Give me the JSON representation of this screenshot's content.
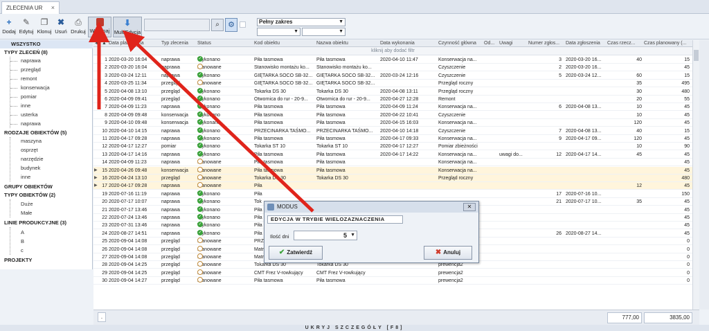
{
  "tab": {
    "label": "ZLECENIA UR"
  },
  "toolbar": {
    "buttons": [
      {
        "label": "Dodaj",
        "icon": "plus-icon"
      },
      {
        "label": "Edytuj",
        "icon": "pencil-icon"
      },
      {
        "label": "Klonuj",
        "icon": "copy-icon"
      },
      {
        "label": "Usuń",
        "icon": "x-icon"
      },
      {
        "label": "Drukuj",
        "icon": "printer-icon"
      },
      {
        "label": "Wykonaj",
        "icon": "execute-icon"
      },
      {
        "label": "MultiEdycja",
        "icon": "multiedit-icon"
      }
    ],
    "range_value": "Pełny zakres"
  },
  "sidebar": {
    "all": "WSZYSTKO",
    "types_header": "TYPY ZLECEŃ (8)",
    "types": [
      "naprawa",
      "przegląd",
      "remont",
      "konserwacja",
      "pomiar",
      "inne",
      "usterka",
      "naprawa"
    ],
    "kinds_header": "RODZAJE OBIEKTÓW (5)",
    "kinds": [
      "maszyna",
      "osprzęt",
      "narzędzie",
      "budynek",
      "inne"
    ],
    "groups_header": "GRUPY OBIEKTÓW",
    "objtypes_header": "TYPY OBIEKTÓW (2)",
    "objtypes": [
      "Duże",
      "Małe"
    ],
    "lines_header": "LINIE PRODUKCYJNE (3)",
    "lines": [
      "A",
      "B",
      "c"
    ],
    "projects": "PROJEKTY"
  },
  "grid": {
    "columns": [
      "Data planowana",
      "Typ zlecenia",
      "Status",
      "Kod obiektu",
      "Nazwa obiektu",
      "Data wykonania",
      "Czynność główna",
      "Od...",
      "Uwagi",
      "Numer zgłos...",
      "Data zgłoszenia",
      "Czas rzecz...",
      "Czas planowany (..."
    ],
    "filter_hint": "kliknij aby dodać filtr",
    "rows": [
      {
        "n": "1",
        "d": "2020-03-20 16:04",
        "t": "naprawa",
        "s": "Wykonano",
        "k": "Piła tasmowa",
        "nz": "Piła tasmowa",
        "dw": "2020-04-10 11:47",
        "c": "Konserwacja na...",
        "u": "",
        "nr": "3",
        "dz": "2020-03-20 16...",
        "cr": "40",
        "cp": "15",
        "hl": false,
        "ok": true
      },
      {
        "n": "2",
        "d": "2020-03-20 16:04",
        "t": "naprawa",
        "s": "Planowane",
        "k": "Stanowisko montażu ko...",
        "nz": "Stanowisko montażu ko...",
        "dw": "",
        "c": "Czyszczenie",
        "u": "",
        "nr": "2",
        "dz": "2020-03-20 16...",
        "cr": "",
        "cp": "45",
        "hl": false,
        "ok": false
      },
      {
        "n": "3",
        "d": "2020-03-24 12:11",
        "t": "naprawa",
        "s": "Wykonano",
        "k": "GIĘTARKA SOCO SB-32...",
        "nz": "GIĘTARKA SOCO SB-32...",
        "dw": "2020-03-24 12:16",
        "c": "Czyszczenie",
        "u": "",
        "nr": "5",
        "dz": "2020-03-24 12...",
        "cr": "60",
        "cp": "15",
        "hl": false,
        "ok": true
      },
      {
        "n": "4",
        "d": "2020-03-25 11:34",
        "t": "przegląd",
        "s": "Planowane",
        "k": "GIĘTARKA SOCO SB-32...",
        "nz": "GIĘTARKA SOCO SB-32...",
        "dw": "",
        "c": "Przegląd roczny",
        "u": "",
        "nr": "",
        "dz": "",
        "cr": "35",
        "cp": "495",
        "hl": false,
        "ok": false
      },
      {
        "n": "5",
        "d": "2020-04-08 13:10",
        "t": "przegląd",
        "s": "Wykonano",
        "k": "Tokarka DS 30",
        "nz": "Tokarka DS 30",
        "dw": "2020-04-08 13:11",
        "c": "Przegląd roczny",
        "u": "",
        "nr": "",
        "dz": "",
        "cr": "30",
        "cp": "480",
        "hl": false,
        "ok": true
      },
      {
        "n": "6",
        "d": "2020-04-09 09:41",
        "t": "przegląd",
        "s": "Wykonano",
        "k": "Otwornica do rur - 20-9...",
        "nz": "Otwornica do rur - 20-9...",
        "dw": "2020-04-27 12:28",
        "c": "Remont",
        "u": "",
        "nr": "",
        "dz": "",
        "cr": "20",
        "cp": "55",
        "hl": false,
        "ok": true
      },
      {
        "n": "7",
        "d": "2020-04-09 11:23",
        "t": "naprawa",
        "s": "Wykonano",
        "k": "Piła tasmowa",
        "nz": "Piła tasmowa",
        "dw": "2020-04-09 11:24",
        "c": "Konserwacja na...",
        "u": "",
        "nr": "6",
        "dz": "2020-04-08 13...",
        "cr": "10",
        "cp": "45",
        "hl": false,
        "ok": true
      },
      {
        "n": "8",
        "d": "2020-04-09 09:48",
        "t": "konserwacja",
        "s": "Wykonano",
        "k": "Piła tasmowa",
        "nz": "Piła tasmowa",
        "dw": "2020-04-22 10:41",
        "c": "Czyszczenie",
        "u": "",
        "nr": "",
        "dz": "",
        "cr": "10",
        "cp": "45",
        "hl": false,
        "ok": true
      },
      {
        "n": "9",
        "d": "2020-04-10 09:48",
        "t": "konserwacja",
        "s": "Wykonano",
        "k": "Piła tasmowa",
        "nz": "Piła tasmowa",
        "dw": "2020-04-15 16:03",
        "c": "Konserwacja na...",
        "u": "",
        "nr": "",
        "dz": "",
        "cr": "120",
        "cp": "45",
        "hl": false,
        "ok": true
      },
      {
        "n": "10",
        "d": "2020-04-10 14:15",
        "t": "naprawa",
        "s": "Wykonano",
        "k": "PRZECINARKA TAŚMO...",
        "nz": "PRZECINARKA TAŚMO...",
        "dw": "2020-04-10 14:18",
        "c": "Czyszczenie",
        "u": "",
        "nr": "7",
        "dz": "2020-04-08 13...",
        "cr": "40",
        "cp": "15",
        "hl": false,
        "ok": true
      },
      {
        "n": "11",
        "d": "2020-04-17 09:28",
        "t": "naprawa",
        "s": "Wykonano",
        "k": "Piła tasmowa",
        "nz": "Piła tasmowa",
        "dw": "2020-04-17 09:33",
        "c": "Konserwacja na...",
        "u": "",
        "nr": "9",
        "dz": "2020-04-17 09...",
        "cr": "120",
        "cp": "45",
        "hl": false,
        "ok": true
      },
      {
        "n": "12",
        "d": "2020-04-17 12:27",
        "t": "pomiar",
        "s": "Wykonano",
        "k": "Tokarka ST 10",
        "nz": "Tokarka ST 10",
        "dw": "2020-04-17 12:27",
        "c": "Pomiar zbieżności",
        "u": "",
        "nr": "",
        "dz": "",
        "cr": "10",
        "cp": "90",
        "hl": false,
        "ok": true
      },
      {
        "n": "13",
        "d": "2020-04-17 14:16",
        "t": "naprawa",
        "s": "Wykonano",
        "k": "Piła tasmowa",
        "nz": "Piła tasmowa",
        "dw": "2020-04-17 14:22",
        "c": "Konserwacja na...",
        "u": "uwagi do...",
        "nr": "12",
        "dz": "2020-04-17 14...",
        "cr": "45",
        "cp": "45",
        "hl": false,
        "ok": true
      },
      {
        "n": "14",
        "d": "2020-04-09 11:23",
        "t": "naprawa",
        "s": "Planowane",
        "k": "Piła tasmowa",
        "nz": "Piła tasmowa",
        "dw": "",
        "c": "Konserwacja na...",
        "u": "",
        "nr": "",
        "dz": "",
        "cr": "",
        "cp": "45",
        "hl": false,
        "ok": false
      },
      {
        "n": "15",
        "d": "2020-04-26 09:48",
        "t": "konserwacja",
        "s": "Planowane",
        "k": "Piła tasmowa",
        "nz": "Piła tasmowa",
        "dw": "",
        "c": "Konserwacja na...",
        "u": "",
        "nr": "",
        "dz": "",
        "cr": "",
        "cp": "45",
        "hl": true,
        "ok": false
      },
      {
        "n": "16",
        "d": "2020-04-24 13:10",
        "t": "przegląd",
        "s": "Planowane",
        "k": "Tokarka DS 30",
        "nz": "Tokarka DS 30",
        "dw": "",
        "c": "Przegląd roczny",
        "u": "",
        "nr": "",
        "dz": "",
        "cr": "",
        "cp": "480",
        "hl": true,
        "ok": false
      },
      {
        "n": "17",
        "d": "2020-04-17 09:28",
        "t": "naprawa",
        "s": "Planowane",
        "k": "Piła",
        "nz": "",
        "dw": "",
        "c": "",
        "u": "",
        "nr": "",
        "dz": "",
        "cr": "12",
        "cp": "45",
        "hl": true,
        "ok": false
      },
      {
        "n": "19",
        "d": "2020-07-16 11:19",
        "t": "naprawa",
        "s": "Wykonano",
        "k": "Piła",
        "nz": "",
        "dw": "",
        "c": "",
        "u": "",
        "nr": "17",
        "dz": "2020-07-16 10...",
        "cr": "",
        "cp": "150",
        "hl": false,
        "ok": true
      },
      {
        "n": "20",
        "d": "2020-07-17 10:07",
        "t": "naprawa",
        "s": "Wykonano",
        "k": "Tok",
        "nz": "",
        "dw": "",
        "c": "",
        "u": "",
        "nr": "21",
        "dz": "2020-07-17 10...",
        "cr": "35",
        "cp": "45",
        "hl": false,
        "ok": true
      },
      {
        "n": "21",
        "d": "2020-07-17 13:46",
        "t": "naprawa",
        "s": "Wykonano",
        "k": "Piła",
        "nz": "",
        "dw": "",
        "c": "",
        "u": "",
        "nr": "",
        "dz": "",
        "cr": "",
        "cp": "45",
        "hl": false,
        "ok": true
      },
      {
        "n": "22",
        "d": "2020-07-24 13:46",
        "t": "naprawa",
        "s": "Wykonano",
        "k": "Piła",
        "nz": "",
        "dw": "",
        "c": "",
        "u": "",
        "nr": "",
        "dz": "",
        "cr": "",
        "cp": "45",
        "hl": false,
        "ok": true
      },
      {
        "n": "23",
        "d": "2020-07-31 13:46",
        "t": "naprawa",
        "s": "Wykonano",
        "k": "Piła",
        "nz": "",
        "dw": "",
        "c": "",
        "u": "",
        "nr": "",
        "dz": "",
        "cr": "",
        "cp": "45",
        "hl": false,
        "ok": true
      },
      {
        "n": "24",
        "d": "2020-08-27 14:51",
        "t": "naprawa",
        "s": "Wykonano",
        "k": "Piła",
        "nz": "",
        "dw": "",
        "c": "",
        "u": "",
        "nr": "26",
        "dz": "2020-08-27 14...",
        "cr": "",
        "cp": "45",
        "hl": false,
        "ok": true
      },
      {
        "n": "25",
        "d": "2020-09-04 14:08",
        "t": "przegląd",
        "s": "Planowane",
        "k": "PRZ",
        "nz": "",
        "dw": "",
        "c": "",
        "u": "",
        "nr": "",
        "dz": "",
        "cr": "",
        "cp": "0",
        "hl": false,
        "ok": false
      },
      {
        "n": "26",
        "d": "2020-09-04 14:08",
        "t": "przegląd",
        "s": "Planowane",
        "k": "Matryca wygładzająca ...",
        "nz": "Matryca wygładzająca ...",
        "dw": "",
        "c": "prewencja2",
        "u": "",
        "nr": "",
        "dz": "",
        "cr": "",
        "cp": "0",
        "hl": false,
        "ok": false
      },
      {
        "n": "27",
        "d": "2020-09-04 14:08",
        "t": "przegląd",
        "s": "Planowane",
        "k": "Matryca prowadząca d...",
        "nz": "Matryca prowadząca d...",
        "dw": "",
        "c": "prewencja2",
        "u": "",
        "nr": "",
        "dz": "",
        "cr": "",
        "cp": "0",
        "hl": false,
        "ok": false
      },
      {
        "n": "28",
        "d": "2020-09-04 14:25",
        "t": "przegląd",
        "s": "Planowane",
        "k": "Tokarka DS 30",
        "nz": "Tokarka DS 30",
        "dw": "",
        "c": "prewencja2",
        "u": "",
        "nr": "",
        "dz": "",
        "cr": "",
        "cp": "0",
        "hl": false,
        "ok": false
      },
      {
        "n": "29",
        "d": "2020-09-04 14:25",
        "t": "przegląd",
        "s": "Planowane",
        "k": "CMT Frez V-rowkujący",
        "nz": "CMT Frez V-rowkujący",
        "dw": "",
        "c": "prewencja2",
        "u": "",
        "nr": "",
        "dz": "",
        "cr": "",
        "cp": "0",
        "hl": false,
        "ok": false
      },
      {
        "n": "30",
        "d": "2020-09-04 14:27",
        "t": "przegląd",
        "s": "Planowane",
        "k": "Piła tasmowa",
        "nz": "Piła tasmowa",
        "dw": "",
        "c": "prewencja2",
        "u": "",
        "nr": "",
        "dz": "",
        "cr": "",
        "cp": "0",
        "hl": false,
        "ok": false
      }
    ]
  },
  "footer": {
    "total_actual": "777,00",
    "total_planned": "3835,00",
    "dot": "."
  },
  "bottom_bar": "UKRYJ SZCZEGÓŁY [F8]",
  "dialog": {
    "title": "MODUS",
    "mode": "EDYCJA W TRYBIE WIELOZAZNACZENIA",
    "qty_label": "Ilość dni",
    "qty_value": "5",
    "confirm": "Zatwierdź",
    "cancel": "Anuluj"
  },
  "colors": {
    "annotation_arrow": "#e0241b",
    "ok_status": "#3aa23a",
    "highlight_row": "#fff5dc"
  }
}
